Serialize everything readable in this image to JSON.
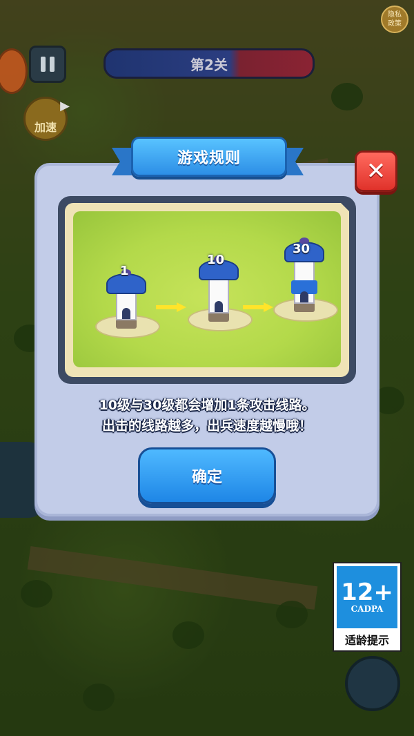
{
  "hud": {
    "privacy_line1": "隐私",
    "privacy_line2": "政策",
    "level_label": "第2关",
    "speed_label": "加速"
  },
  "modal": {
    "title": "游戏规则",
    "close_icon": "x-icon",
    "towers": [
      {
        "level": "1"
      },
      {
        "level": "10"
      },
      {
        "level": "30"
      }
    ],
    "description_line1": "10级与30级都会增加1条攻击线路。",
    "description_line2": "出击的线路越多，出兵速度越慢哦！",
    "confirm_label": "确定"
  },
  "age_rating": {
    "rating": "12+",
    "org": "CADPA",
    "tip": "适龄提示"
  },
  "colors": {
    "accent_blue": "#2d8fe6",
    "close_red": "#e0322b",
    "modal_bg": "#c2cce8"
  }
}
